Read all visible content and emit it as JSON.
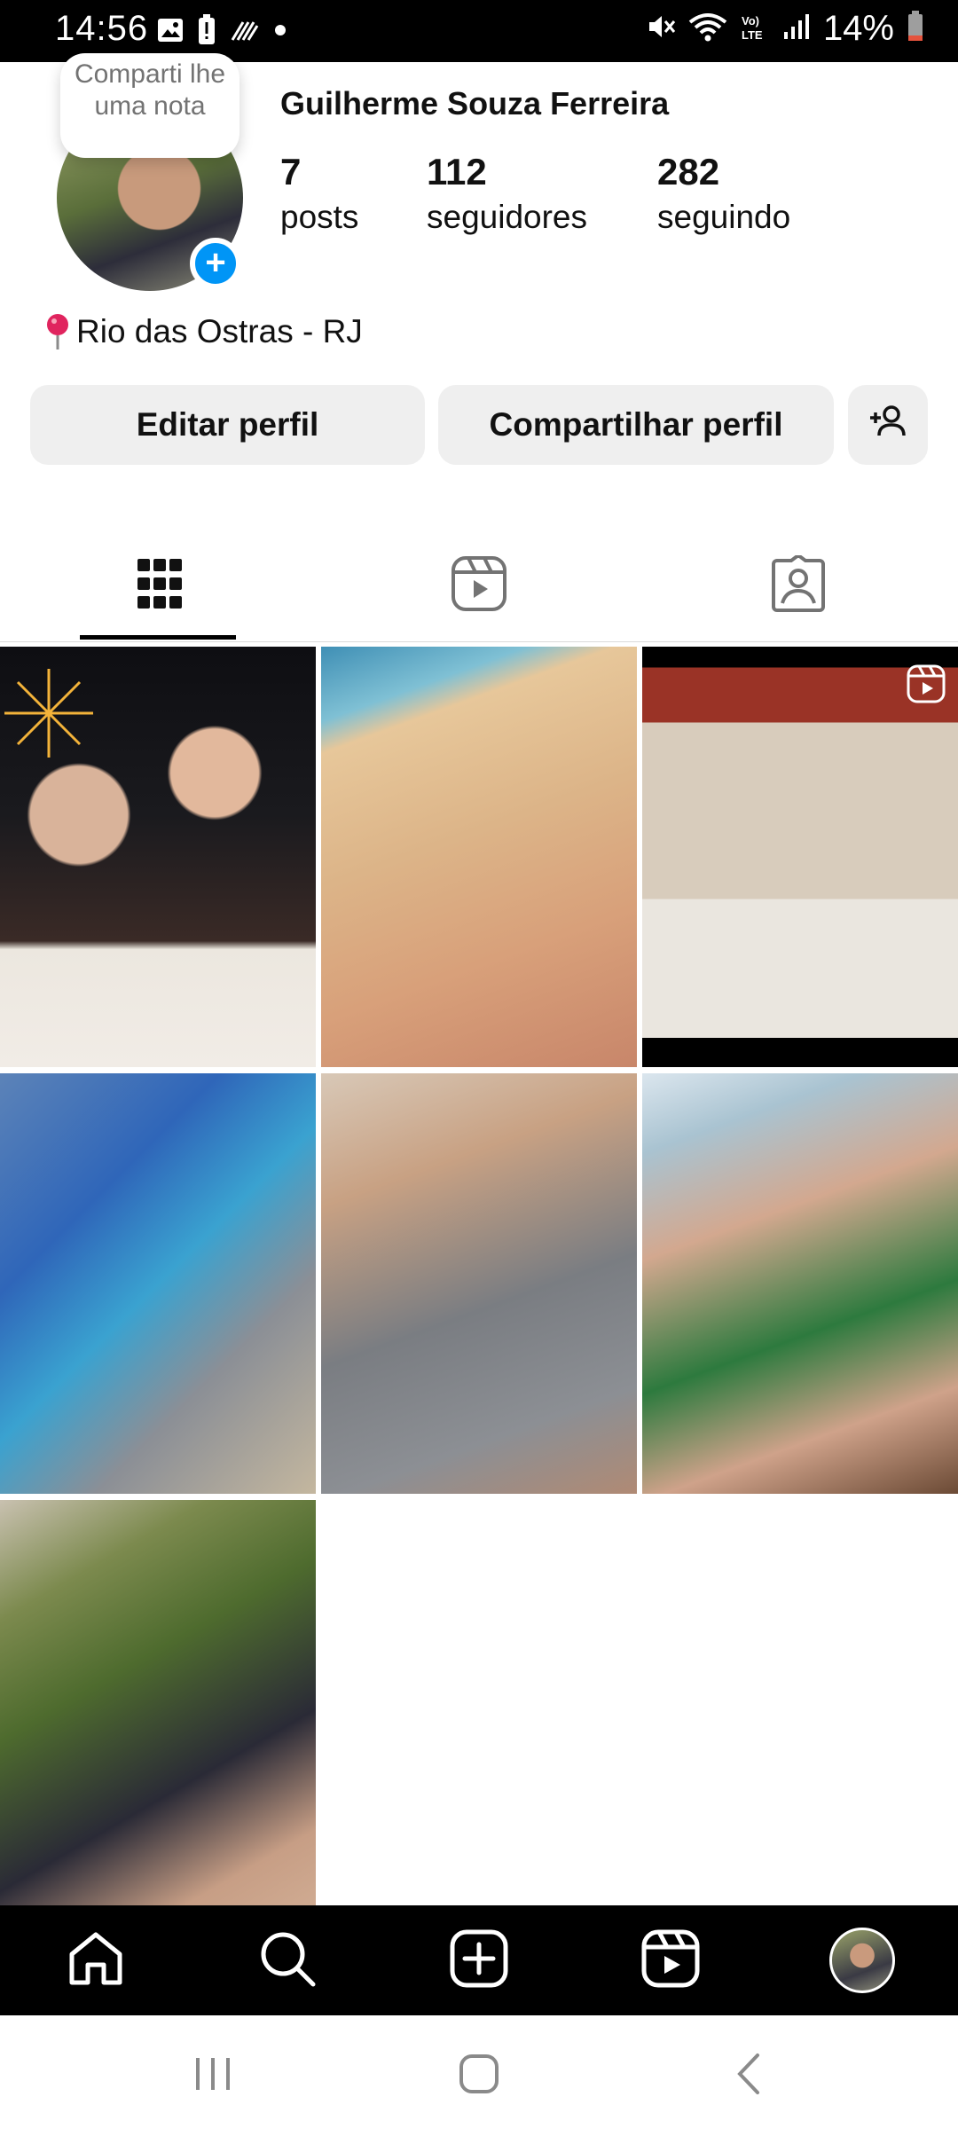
{
  "status_bar": {
    "time": "14:56",
    "battery_percent": "14%",
    "left_icons": [
      "image-icon",
      "battery-alert-icon",
      "data-saver-icon",
      "dot-icon"
    ],
    "right_icons": [
      "mute-icon",
      "wifi-icon",
      "volte-icon",
      "signal-icon",
      "battery-icon"
    ]
  },
  "profile": {
    "note_text": "Comparti lhe uma nota",
    "name": "Guilherme Souza Ferreira",
    "posts_count": "7",
    "posts_label": "posts",
    "followers_count": "112",
    "followers_label": "seguidores",
    "following_count": "282",
    "following_label": "seguindo",
    "location": "Rio das Ostras - RJ"
  },
  "actions": {
    "edit_label": "Editar perfil",
    "share_label": "Compartilhar perfil"
  },
  "tabs": {
    "active": "grid",
    "items": [
      "grid-icon",
      "reels-icon",
      "tagged-icon"
    ]
  },
  "grid": {
    "post_count": 7
  },
  "bottom_nav": {
    "items": [
      "home-icon",
      "search-icon",
      "create-icon",
      "reels-icon",
      "profile-avatar"
    ]
  },
  "colors": {
    "accent_blue": "#0095f6",
    "button_bg": "#efefef",
    "nav_bg": "#000000"
  }
}
